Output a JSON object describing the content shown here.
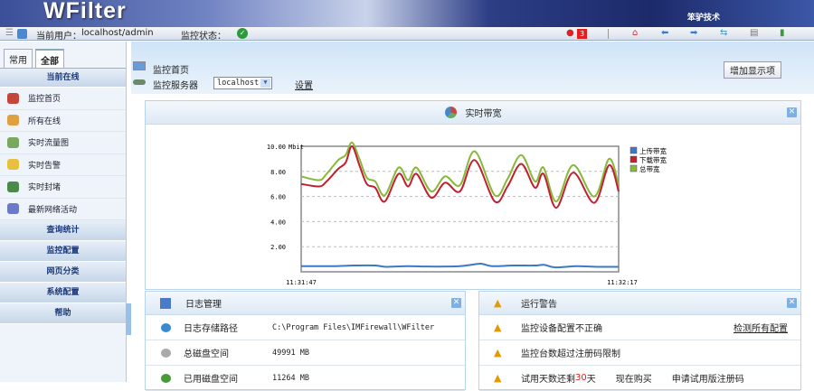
{
  "header": {
    "logo": "WFilter",
    "brand": "笨驴技术"
  },
  "toolbar": {
    "user_label": "当前用户：",
    "user": "localhost/admin",
    "status_label": "监控状态：",
    "alert_count": "3"
  },
  "sidebar": {
    "tabs": [
      "常用",
      "全部"
    ],
    "section_online": "当前在线",
    "items": [
      {
        "label": "监控首页",
        "icon": "home-icon",
        "color": "#c4463a"
      },
      {
        "label": "所有在线",
        "icon": "users-icon",
        "color": "#e0a040"
      },
      {
        "label": "实时流量图",
        "icon": "pie-chart-icon",
        "color": "#7aa860"
      },
      {
        "label": "实时告警",
        "icon": "calendar-alert-icon",
        "color": "#e8c040"
      },
      {
        "label": "实时封堵",
        "icon": "block-icon",
        "color": "#4a8a4a"
      },
      {
        "label": "最新网络活动",
        "icon": "bar-chart-icon",
        "color": "#6a7ac8"
      }
    ],
    "sections": [
      "查询统计",
      "监控配置",
      "网页分类",
      "系统配置",
      "帮助"
    ]
  },
  "main": {
    "title": "监控首页",
    "server_label": "监控服务器",
    "server_value": "localhost",
    "settings_link": "设置",
    "add_button": "增加显示项"
  },
  "chart_panel": {
    "title": "实时带宽"
  },
  "chart_data": {
    "type": "line",
    "title": "实时带宽",
    "unit": "Mbit",
    "ylim": [
      0,
      10
    ],
    "yticks": [
      "2.00",
      "4.00",
      "6.00",
      "8.00",
      "10.00"
    ],
    "xlabels": [
      "11:31:47",
      "11:32:17"
    ],
    "x_range_seconds": [
      0,
      30
    ],
    "series": [
      {
        "name": "上传带宽",
        "color": "#3a78c8",
        "points": [
          [
            0,
            0.45
          ],
          [
            3,
            0.45
          ],
          [
            5,
            0.5
          ],
          [
            7,
            0.5
          ],
          [
            8,
            0.4
          ],
          [
            10,
            0.45
          ],
          [
            12,
            0.42
          ],
          [
            14,
            0.42
          ],
          [
            15,
            0.45
          ],
          [
            16,
            0.55
          ],
          [
            17,
            0.65
          ],
          [
            18,
            0.45
          ],
          [
            20,
            0.5
          ],
          [
            22,
            0.5
          ],
          [
            23,
            0.55
          ],
          [
            24,
            0.35
          ],
          [
            26,
            0.45
          ],
          [
            28,
            0.4
          ],
          [
            30,
            0.4
          ]
        ]
      },
      {
        "name": "下载带宽",
        "color": "#c02030",
        "points": [
          [
            0,
            7.0
          ],
          [
            1.7,
            6.8
          ],
          [
            2.4,
            7.2
          ],
          [
            3.5,
            8.2
          ],
          [
            4.2,
            8.7
          ],
          [
            4.8,
            10.0
          ],
          [
            5.5,
            8.5
          ],
          [
            6.2,
            7.0
          ],
          [
            7.0,
            6.7
          ],
          [
            7.9,
            5.6
          ],
          [
            9.2,
            7.8
          ],
          [
            10.1,
            6.8
          ],
          [
            10.9,
            7.8
          ],
          [
            12.3,
            5.9
          ],
          [
            13.6,
            7.1
          ],
          [
            15.0,
            6.4
          ],
          [
            16.4,
            8.9
          ],
          [
            18.3,
            5.6
          ],
          [
            19.5,
            6.8
          ],
          [
            20.8,
            8.6
          ],
          [
            22.1,
            6.7
          ],
          [
            22.9,
            7.8
          ],
          [
            24.1,
            5.1
          ],
          [
            25.7,
            7.9
          ],
          [
            27.7,
            5.5
          ],
          [
            29.1,
            8.5
          ],
          [
            30,
            6.4
          ]
        ]
      },
      {
        "name": "总带宽",
        "color": "#88b83a",
        "points": [
          [
            0,
            7.6
          ],
          [
            1.7,
            7.3
          ],
          [
            2.4,
            7.8
          ],
          [
            3.5,
            8.9
          ],
          [
            4.2,
            9.3
          ],
          [
            4.8,
            10.3
          ],
          [
            5.5,
            9.0
          ],
          [
            6.2,
            7.5
          ],
          [
            7.0,
            7.2
          ],
          [
            7.9,
            6.1
          ],
          [
            9.2,
            8.3
          ],
          [
            10.1,
            7.3
          ],
          [
            10.9,
            8.3
          ],
          [
            12.3,
            6.4
          ],
          [
            13.6,
            7.6
          ],
          [
            15.0,
            6.9
          ],
          [
            16.4,
            9.6
          ],
          [
            18.3,
            6.1
          ],
          [
            19.5,
            7.4
          ],
          [
            20.8,
            9.3
          ],
          [
            22.1,
            7.2
          ],
          [
            22.9,
            8.3
          ],
          [
            24.1,
            5.6
          ],
          [
            25.7,
            8.5
          ],
          [
            27.7,
            6.0
          ],
          [
            29.1,
            9.0
          ],
          [
            30,
            6.9
          ]
        ]
      }
    ]
  },
  "log_panel": {
    "title": "日志管理",
    "rows": [
      {
        "label": "日志存储路径",
        "value": "C:\\Program Files\\IMFirewall\\WFilter"
      },
      {
        "label": "总磁盘空间",
        "value": "49991  MB"
      },
      {
        "label": "已用磁盘空间",
        "value": "11264  MB"
      }
    ]
  },
  "warn_panel": {
    "title": "运行警告",
    "rows": [
      {
        "label": "监控设备配置不正确",
        "link": "检测所有配置"
      },
      {
        "label": "监控台数超过注册码限制"
      }
    ],
    "trial": {
      "prefix": "试用天数还剩",
      "days": "30",
      "suffix": "天",
      "buy": "现在购买",
      "apply": "申请试用版注册码"
    }
  }
}
